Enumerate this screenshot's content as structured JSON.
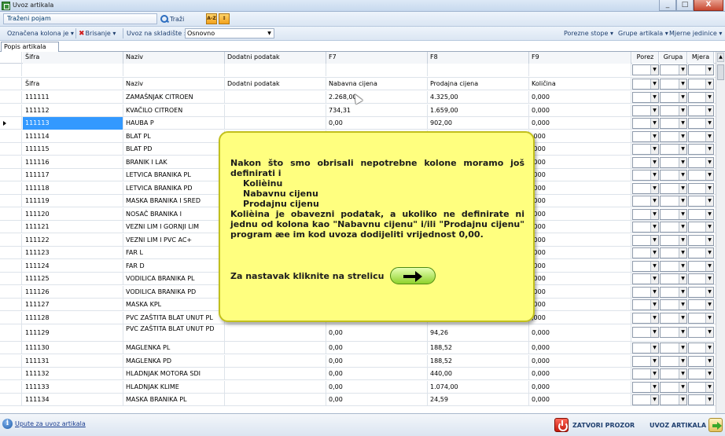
{
  "window": {
    "title": "Uvoz artikala",
    "min": "_",
    "max": "□",
    "close": "X"
  },
  "toolbar1": {
    "search_placeholder": "Traženi pojam",
    "search_label": "Traži",
    "sort_asc": "A-Z",
    "sort_desc": "↕"
  },
  "toolbar2": {
    "column_label": "Označena kolona je",
    "delete_label": "Brisanje",
    "warehouse_label": "Uvoz na skladište :",
    "warehouse_value": "Osnovno",
    "tax_rates": "Porezne stope",
    "item_groups": "Grupe artikala",
    "units": "Mjerne jedinice"
  },
  "tab": "Popis artikala",
  "columns": [
    "Šifra",
    "Naziv",
    "Dodatni podatak",
    "F7",
    "F8",
    "F9",
    "Porez",
    "Grupa",
    "Mjera"
  ],
  "mapping_row": [
    "Šifra",
    "Naziv",
    "Dodatni podatak",
    "Nabavna cijena",
    "Prodajna cijena",
    "Količina"
  ],
  "rows": [
    [
      "111111",
      "ZAMAŠNJAK CITROEN",
      "",
      "2.268,00",
      "4.325,00",
      "0,000"
    ],
    [
      "111112",
      "KVAČILO CITROEN",
      "",
      "734,31",
      "1.659,00",
      "0,000"
    ],
    [
      "111113",
      "HAUBA P",
      "",
      "0,00",
      "902,00",
      "0,000"
    ],
    [
      "111114",
      "BLAT PL",
      "",
      "",
      "",
      ",000"
    ],
    [
      "111115",
      "BLAT PD",
      "",
      "",
      "",
      ",000"
    ],
    [
      "111116",
      "BRANIK I LAK",
      "",
      "",
      "",
      ",000"
    ],
    [
      "111117",
      "LETVICA BRANIKA PL",
      "",
      "",
      "",
      ",000"
    ],
    [
      "111118",
      "LETVICA BRANIKA PD",
      "",
      "",
      "",
      ",000"
    ],
    [
      "111119",
      "MASKA BRANIKA I SRED",
      "",
      "",
      "",
      ",000"
    ],
    [
      "111120",
      "NOSAČ BRANIKA I",
      "",
      "",
      "",
      ",000"
    ],
    [
      "111121",
      "VEZNI LIM I GORNJI LIM",
      "",
      "",
      "",
      ",000"
    ],
    [
      "111122",
      "VEZNI LIM I PVC AC+",
      "",
      "",
      "",
      ",000"
    ],
    [
      "111123",
      "FAR L",
      "",
      "",
      "",
      ",000"
    ],
    [
      "111124",
      "FAR D",
      "",
      "",
      "",
      ",000"
    ],
    [
      "111125",
      "VODILICA BRANIKA PL",
      "",
      "",
      "",
      ",000"
    ],
    [
      "111126",
      "VODILICA BRANIKA PD",
      "",
      "",
      "",
      ",000"
    ],
    [
      "111127",
      "MASKA KPL",
      "",
      "",
      "",
      ",000"
    ],
    [
      "111128",
      "PVC ZAŠTITA BLAT UNUT PL",
      "",
      "",
      "",
      ",000"
    ],
    [
      "111129",
      "PVC ZAŠTITA BLAT UNUT PD",
      "",
      "0,00",
      "94,26",
      "0,000"
    ],
    [
      "111130",
      "MAGLENKA PL",
      "",
      "0,00",
      "188,52",
      "0,000"
    ],
    [
      "111131",
      "MAGLENKA PD",
      "",
      "0,00",
      "188,52",
      "0,000"
    ],
    [
      "111132",
      "HLADNJAK MOTORA SDI",
      "",
      "0,00",
      "440,00",
      "0,000"
    ],
    [
      "111133",
      "HLADNJAK KLIME",
      "",
      "0,00",
      "1.074,00",
      "0,000"
    ],
    [
      "111134",
      "MASKA BRANIKA PL",
      "",
      "0,00",
      "24,59",
      "0,000"
    ]
  ],
  "callout": {
    "line1": "Nakon što smo obrisali nepotrebne kolone moramo još definirati i",
    "item1": "Kolièinu",
    "item2": "Nabavnu cijenu",
    "item3": "Prodajnu cijenu",
    "para": "Kolièina je obavezni podatak, a ukoliko ne definirate ni jednu od kolona kao \"Nabavnu cijenu\" i/ili \"Prodajnu cijenu\" program æe im kod uvoza dodijeliti vrijednost 0,00.",
    "next": "Za nastavak kliknite na strelicu"
  },
  "footer": {
    "help": "Upute za uvoz artikala",
    "close": "ZATVORI PROZOR",
    "import": "UVOZ ARTIKALA"
  },
  "icons": [
    "app-icon",
    "search-icon",
    "sort-asc-icon",
    "sort-desc-icon",
    "delete-x-icon",
    "info-icon",
    "power-icon",
    "import-arrow-icon",
    "next-arrow-icon",
    "row-pointer-icon"
  ],
  "colors": {
    "selected": "#3399ff",
    "callout_bg": "#ffff7f",
    "callout_border": "#c2c01c",
    "arrow_green": "#8fd22c"
  }
}
